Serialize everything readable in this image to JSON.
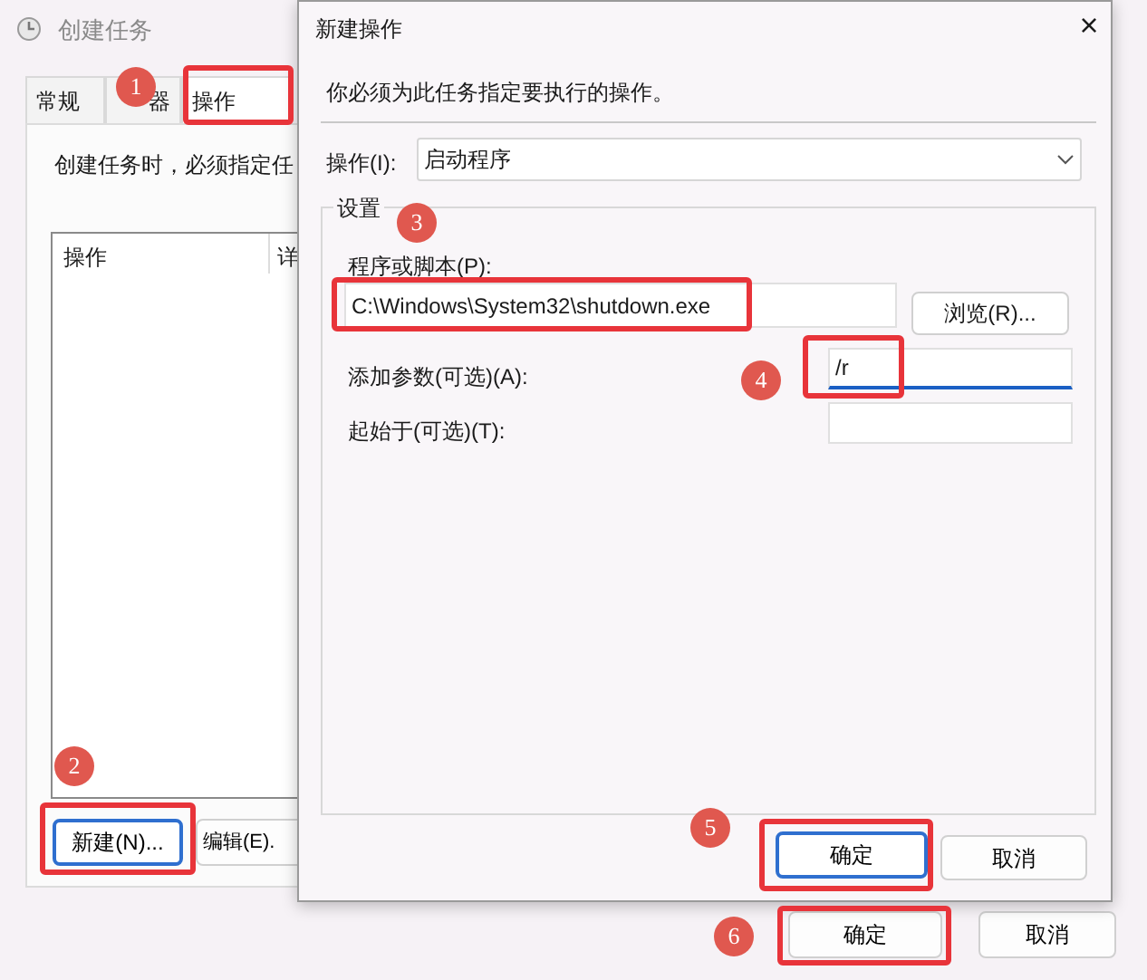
{
  "window": {
    "title": "创建任务"
  },
  "tabs": [
    {
      "label": "常规",
      "selected": false
    },
    {
      "label": "器",
      "selected": false
    },
    {
      "label": "操作",
      "selected": true
    }
  ],
  "panel": {
    "hint": "创建任务时，必须指定任",
    "columns": [
      "操作",
      "详"
    ]
  },
  "panel_buttons": [
    {
      "label": "新建(N)...",
      "focused": true
    },
    {
      "label": "编辑(E).",
      "focused": false
    }
  ],
  "footer_buttons": [
    {
      "label": "确定",
      "focused": false
    },
    {
      "label": "取消",
      "focused": false
    }
  ],
  "dialog": {
    "title": "新建操作",
    "close": "×",
    "instruction": "你必须为此任务指定要执行的操作。",
    "action_label": "操作(I):",
    "action_value": "启动程序",
    "group_title": "设置",
    "program_label": "程序或脚本(P):",
    "program_value": "C:\\Windows\\System32\\shutdown.exe",
    "browse": "浏览(R)...",
    "args_label": "添加参数(可选)(A):",
    "args_value": "/r",
    "start_label": "起始于(可选)(T):",
    "buttons": [
      {
        "label": "确定",
        "focused": true
      },
      {
        "label": "取消",
        "focused": false
      }
    ]
  },
  "annotations": [
    {
      "number": "1"
    },
    {
      "number": "2"
    },
    {
      "number": "3"
    },
    {
      "number": "4"
    },
    {
      "number": "5"
    },
    {
      "number": "6"
    }
  ]
}
